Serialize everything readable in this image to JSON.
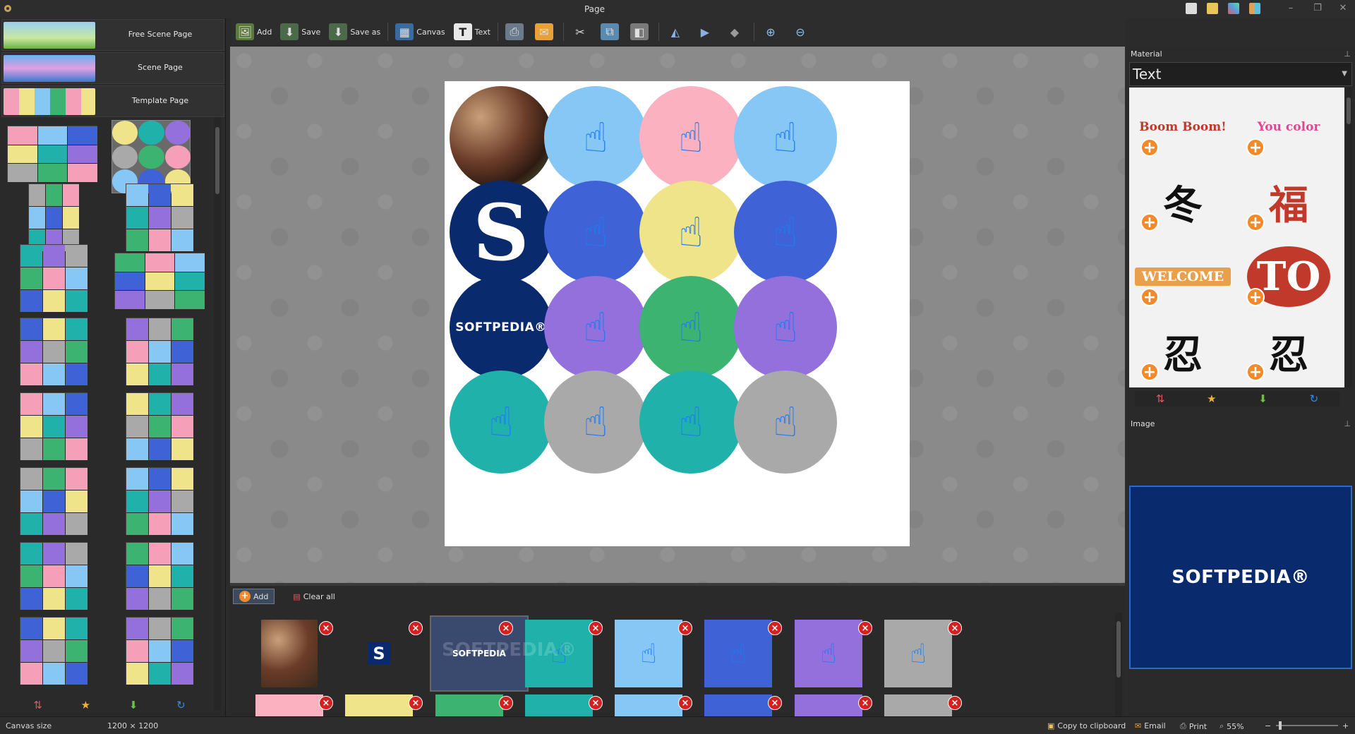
{
  "window": {
    "title": "Page"
  },
  "left_panel": {
    "page_types": [
      {
        "label": "Free Scene Page"
      },
      {
        "label": "Scene Page"
      },
      {
        "label": "Template Page"
      }
    ]
  },
  "toolbar": {
    "add": "Add",
    "save": "Save",
    "save_as": "Save as",
    "canvas": "Canvas",
    "text": "Text"
  },
  "canvas": {
    "circles": [
      {
        "kind": "photo"
      },
      {
        "kind": "hand",
        "color": "#87c7f5"
      },
      {
        "kind": "hand",
        "color": "#fbb1bf"
      },
      {
        "kind": "hand",
        "color": "#87c7f5"
      },
      {
        "kind": "s-logo",
        "text": "S"
      },
      {
        "kind": "hand",
        "color": "#3f62d6"
      },
      {
        "kind": "hand",
        "color": "#f0e48a"
      },
      {
        "kind": "hand",
        "color": "#3f62d6"
      },
      {
        "kind": "logo",
        "text": "SOFTPEDIA®"
      },
      {
        "kind": "hand",
        "color": "#9370db"
      },
      {
        "kind": "hand",
        "color": "#3cb371"
      },
      {
        "kind": "hand",
        "color": "#9370db"
      },
      {
        "kind": "hand",
        "color": "#20b2aa"
      },
      {
        "kind": "hand",
        "color": "#a9a9a9"
      },
      {
        "kind": "hand",
        "color": "#20b2aa"
      },
      {
        "kind": "hand",
        "color": "#a9a9a9"
      }
    ]
  },
  "strip": {
    "add": "Add",
    "clear_all": "Clear all",
    "watermark": "SOFTPEDIA®",
    "row1": [
      {
        "kind": "photo"
      },
      {
        "kind": "s-logo",
        "text": "S"
      },
      {
        "kind": "logo",
        "text": "SOFTPEDIA"
      },
      {
        "kind": "hand",
        "color": "#20b2aa"
      },
      {
        "kind": "hand",
        "color": "#87c7f5"
      },
      {
        "kind": "hand",
        "color": "#3f62d6"
      },
      {
        "kind": "hand",
        "color": "#9370db"
      },
      {
        "kind": "hand",
        "color": "#a9a9a9"
      }
    ],
    "row2": [
      "#fbb1bf",
      "#f0e48a",
      "#3cb371",
      "#20b2aa",
      "#87c7f5",
      "#3f62d6",
      "#9370db",
      "#a9a9a9"
    ]
  },
  "right_panel": {
    "material_title": "Material",
    "material_select": "Text",
    "image_title": "Image",
    "image_preview_text": "SOFTPEDIA®",
    "materials": [
      {
        "text": "Boom Boom!",
        "color": "#c0392b"
      },
      {
        "text": "You color",
        "color": "#e84393"
      },
      {
        "text": "冬",
        "color": "#111111"
      },
      {
        "text": "福",
        "color": "#c0392b"
      },
      {
        "text": "WELCOME",
        "color": "#ffffff",
        "bg": "#e8a04a"
      },
      {
        "text": "TO",
        "color": "#ffffff",
        "bg": "#c0392b"
      },
      {
        "text": "忍",
        "color": "#111111"
      },
      {
        "text": "忍",
        "color": "#111111"
      }
    ]
  },
  "status": {
    "canvas_size_label": "Canvas size",
    "canvas_size_value": "1200 × 1200",
    "copy": "Copy to clipboard",
    "email": "Email",
    "print": "Print",
    "zoom": "55%"
  }
}
